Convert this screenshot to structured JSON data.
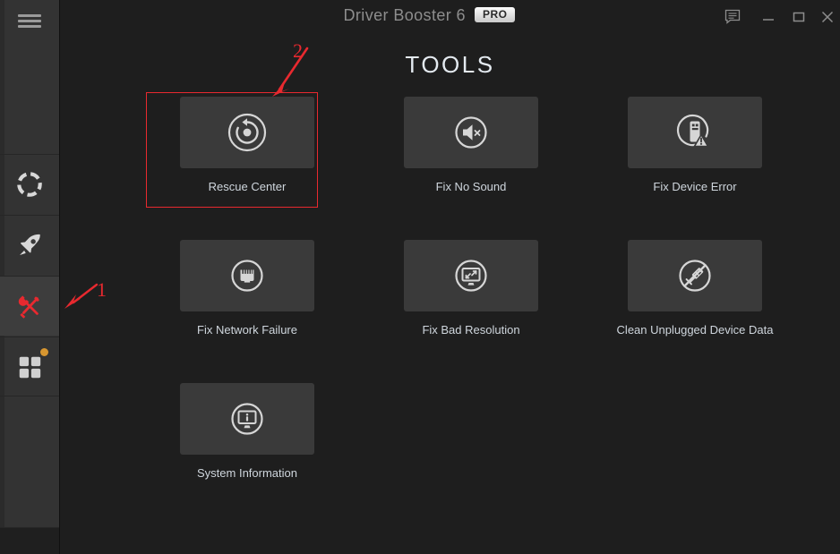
{
  "window": {
    "title": "Driver Booster 6",
    "pro_badge": "PRO",
    "controls": [
      {
        "name": "feedback-button",
        "icon": "chat-bubble-icon"
      },
      {
        "name": "minimize-button",
        "icon": "minimize-icon"
      },
      {
        "name": "maximize-button",
        "icon": "maximize-icon"
      },
      {
        "name": "close-button",
        "icon": "close-icon"
      }
    ]
  },
  "sidebar": {
    "menu": {
      "icon": "hamburger-menu-icon"
    },
    "items": [
      {
        "icon": "lifebuoy-scan-icon",
        "active": false,
        "badge": false
      },
      {
        "icon": "rocket-boost-icon",
        "active": false,
        "badge": false
      },
      {
        "icon": "tools-wrench-screwdriver-icon",
        "active": true,
        "badge": false
      },
      {
        "icon": "grid-squares-icon",
        "active": false,
        "badge": true
      }
    ],
    "badge_color": "#d79630",
    "active_color": "#e8292f"
  },
  "main": {
    "page_title": "TOOLS",
    "tools": [
      {
        "label": "Rescue Center",
        "icon": "restore-circle-arrow-icon"
      },
      {
        "label": "Fix No Sound",
        "icon": "speaker-mute-icon"
      },
      {
        "label": "Fix Device Error",
        "icon": "usb-device-warning-icon"
      },
      {
        "label": "Fix Network Failure",
        "icon": "ethernet-port-icon"
      },
      {
        "label": "Fix Bad Resolution",
        "icon": "monitor-resize-icon"
      },
      {
        "label": "Clean Unplugged Device Data",
        "icon": "usb-plug-blocked-icon"
      },
      {
        "label": "System Information",
        "icon": "monitor-info-icon"
      }
    ]
  },
  "annotations": {
    "color": "#e8292f",
    "markers": [
      {
        "label": "1",
        "target": "sidebar-item-tools"
      },
      {
        "label": "2",
        "target": "tool-rescue-center"
      }
    ]
  }
}
